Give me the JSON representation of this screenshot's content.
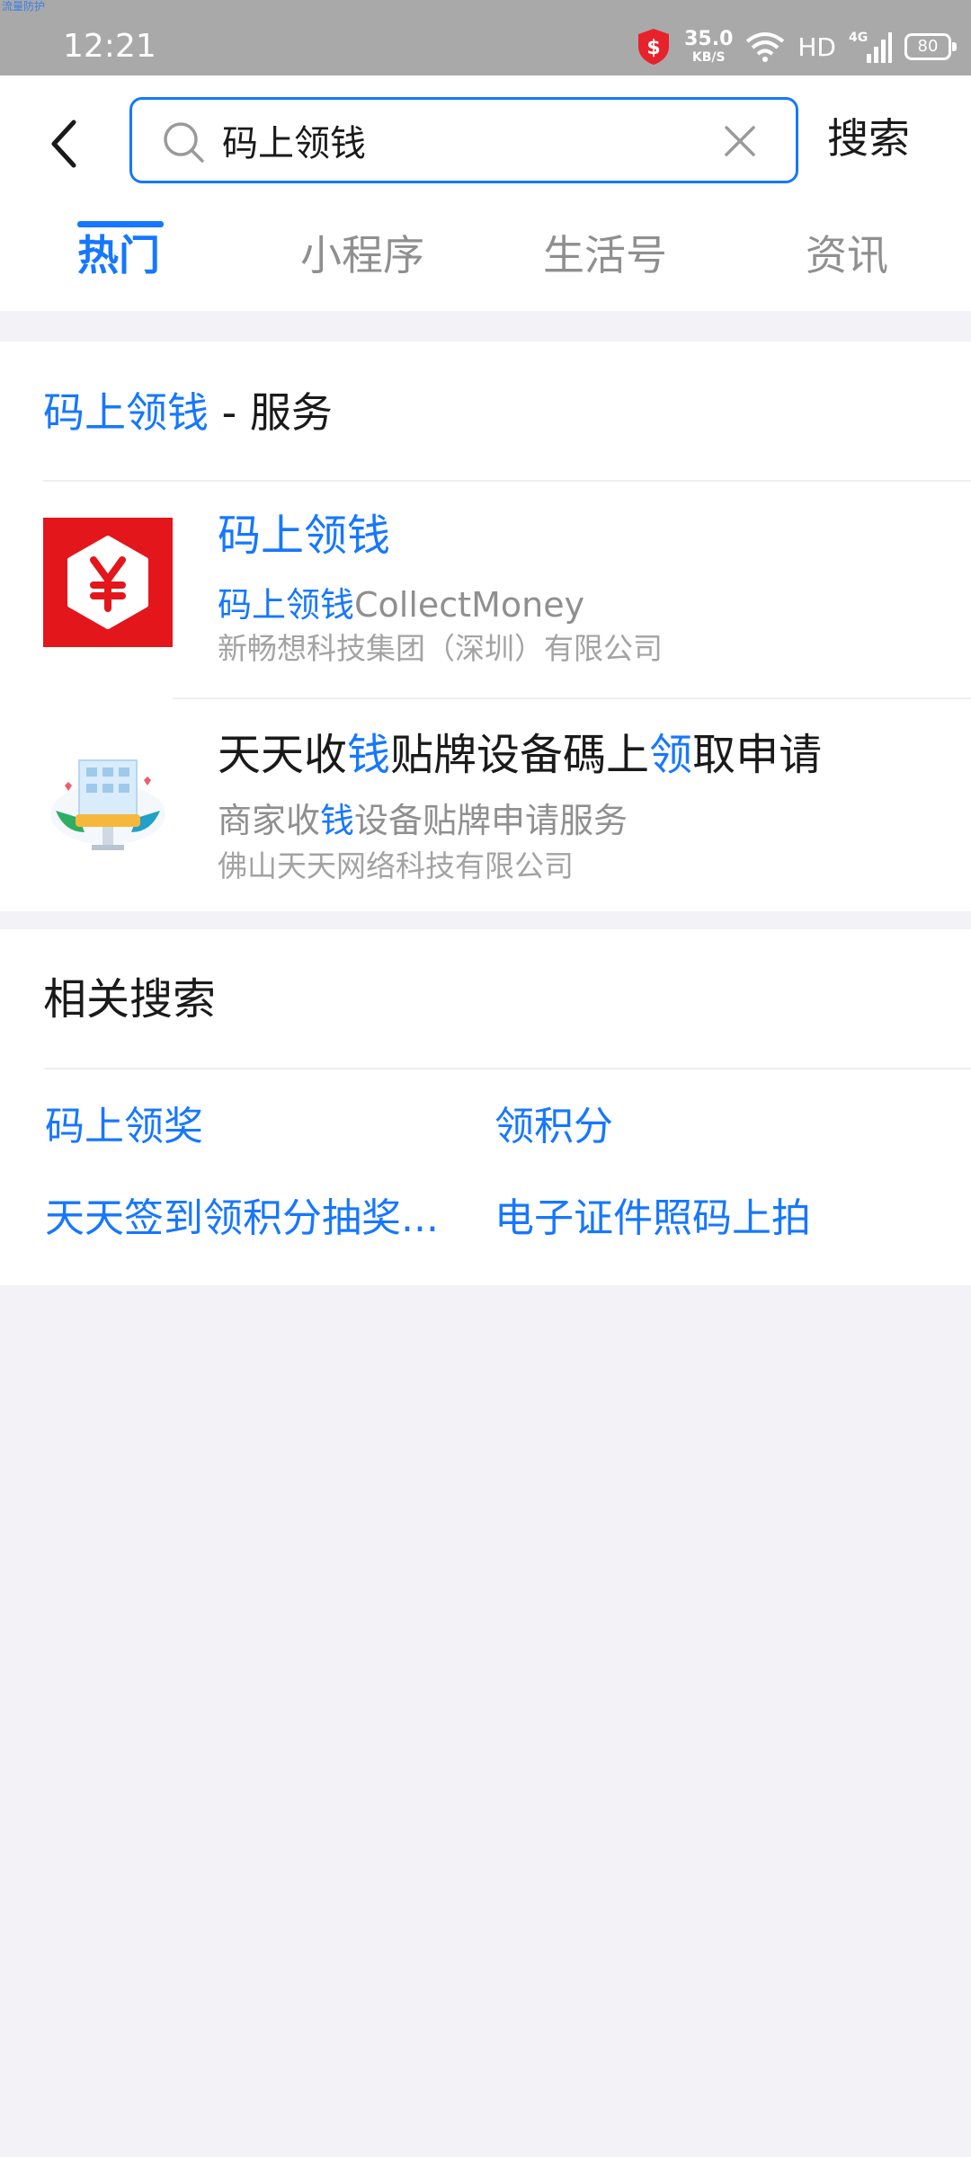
{
  "status_bar": {
    "tiny_label": "流量防护",
    "time": "12:21",
    "net_speed": "35.0",
    "net_speed_unit": "KB/S",
    "hd": "HD",
    "battery": "80"
  },
  "search": {
    "value": "码上领钱",
    "button_label": "搜索"
  },
  "tabs": [
    {
      "label": "热门",
      "active": true
    },
    {
      "label": "小程序",
      "active": false
    },
    {
      "label": "生活号",
      "active": false
    },
    {
      "label": "资讯",
      "active": false
    }
  ],
  "service_section": {
    "title_keyword": "码上领钱",
    "title_suffix": " - 服务",
    "results": [
      {
        "title": "码上领钱",
        "subtitle_keyword": "码上领钱",
        "subtitle_rest": "CollectMoney",
        "org": "新畅想科技集团（深圳）有限公司",
        "icon": "yuan-badge-icon"
      },
      {
        "title_parts": [
          "天天收",
          "钱",
          "贴牌设备碼上",
          "领",
          "取申请"
        ],
        "subtitle_parts": [
          "商家收",
          "钱",
          "设备贴牌申请服务"
        ],
        "org": "佛山天天网络科技有限公司",
        "icon": "building-illustration-icon"
      }
    ]
  },
  "related": {
    "title": "相关搜索",
    "items": [
      "码上领奖",
      "领积分",
      "天天签到领积分抽奖...",
      "电子证件照码上拍"
    ]
  },
  "colors": {
    "accent": "#1677ff",
    "status_bar_bg": "#a9a9a9",
    "page_bg": "#f2f2f7",
    "brand_red": "#e3161c"
  }
}
